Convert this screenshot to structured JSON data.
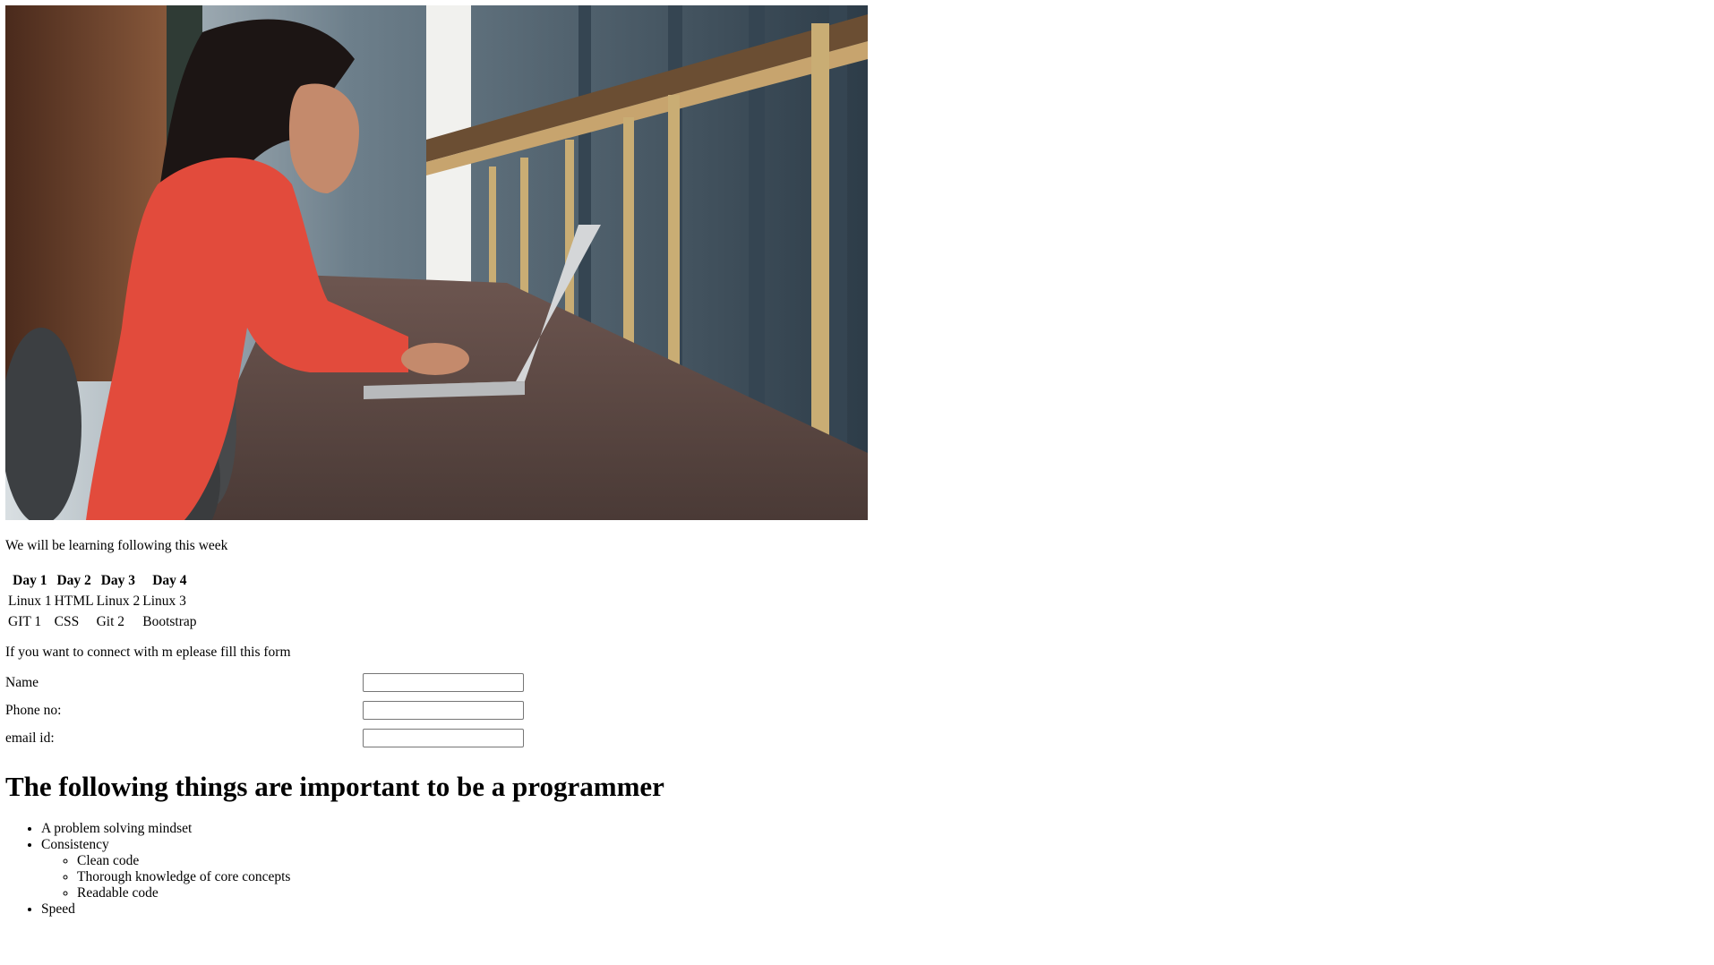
{
  "hero": {
    "image": "woman-working-on-laptop-photo"
  },
  "intro_text": "We will be learning following this week",
  "schedule": {
    "headers": [
      "Day 1",
      "Day 2",
      "Day 3",
      "Day 4"
    ],
    "rows": [
      [
        "Linux 1",
        "HTML",
        "Linux 2",
        "Linux 3"
      ],
      [
        "GIT 1",
        "CSS",
        "Git 2",
        "Bootstrap"
      ]
    ]
  },
  "connect_text": "If you want to connect with m eplease fill this form",
  "form": {
    "name_label": "Name",
    "name_value": "",
    "phone_label": "Phone no:",
    "phone_value": "",
    "email_label": "email id:",
    "email_value": ""
  },
  "heading": "The following things are important to be a programmer",
  "list": {
    "item1": "A problem solving mindset",
    "item2": "Consistency",
    "sub1": "Clean code",
    "sub2": "Thorough knowledge of core concepts",
    "sub3": "Readable code",
    "item3": "Speed"
  }
}
